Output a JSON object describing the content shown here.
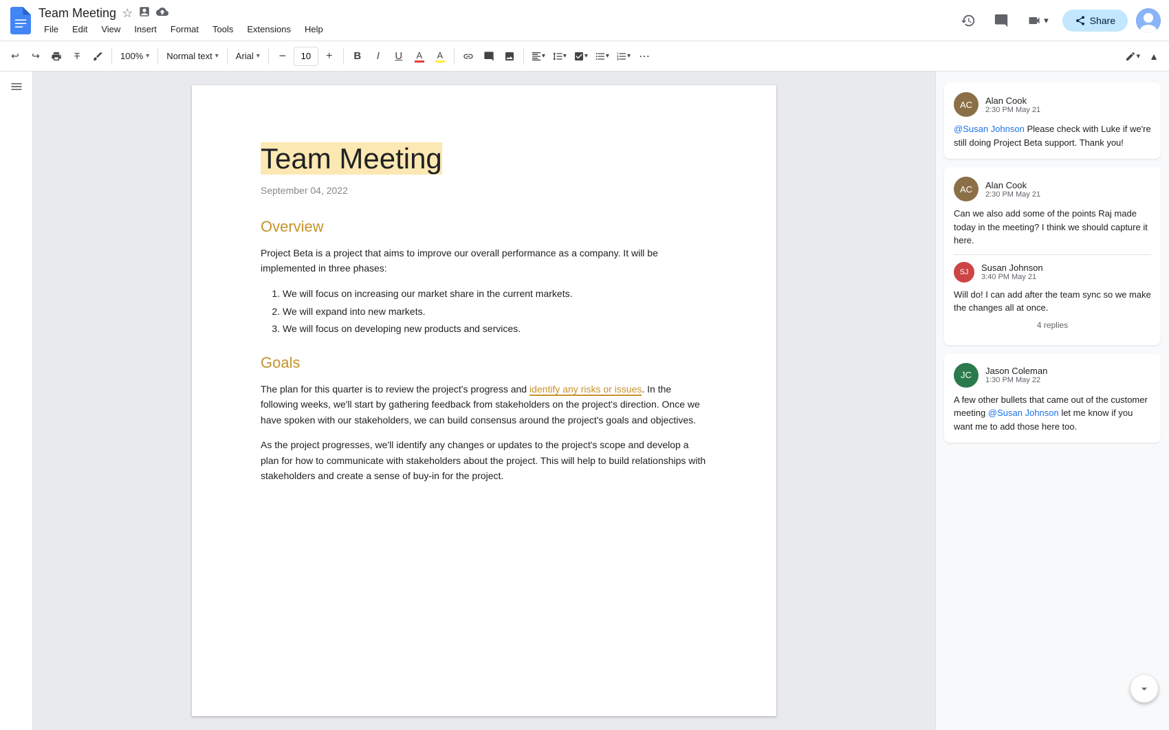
{
  "appbar": {
    "doc_title": "Team Meeting",
    "star_icon": "⭐",
    "drive_icon": "📁",
    "cloud_icon": "☁",
    "share_label": "Share",
    "history_icon": "🕐",
    "comment_icon": "💬",
    "video_icon": "📹"
  },
  "menu": {
    "items": [
      "File",
      "Edit",
      "View",
      "Insert",
      "Format",
      "Tools",
      "Extensions",
      "Help"
    ]
  },
  "toolbar": {
    "undo": "↩",
    "redo": "↪",
    "print": "🖨",
    "format_clear": "T̲",
    "paint_format": "🖌",
    "zoom": "100%",
    "text_style": "Normal text",
    "font": "Arial",
    "font_size": "10",
    "bold": "B",
    "italic": "I",
    "underline": "U",
    "text_color": "A",
    "highlight": "A",
    "link": "🔗",
    "comment": "💬",
    "image": "🖼",
    "align": "≡",
    "line_spacing": "↕",
    "checklist": "☑",
    "bullet_list": "•",
    "numbered_list": "1",
    "more": "⋯",
    "editing_mode": "✏",
    "collapse": "▲"
  },
  "document": {
    "title": "Team Meeting",
    "date": "September 04, 2022",
    "sections": [
      {
        "heading": "Overview",
        "content": "Project Beta is a project that aims to improve our overall performance as a company. It will be implemented in three phases:",
        "list": [
          "We will focus on increasing our market share in the current markets.",
          "We will expand into new markets.",
          "We will focus on developing new products and services."
        ]
      },
      {
        "heading": "Goals",
        "content_before": "The plan for this quarter is to review the project's progress and ",
        "highlighted": "identify any risks or issues",
        "content_after": ". In the following weeks, we'll start by gathering feedback from stakeholders on the project's direction. Once we have spoken with our stakeholders, we can build consensus around the project's goals and objectives.",
        "content2": "As the project progresses, we'll identify any changes or updates to the project's scope and develop a plan for how to communicate with stakeholders about the project. This will help to build relationships with stakeholders and create a sense of buy-in for the project."
      }
    ]
  },
  "comments": [
    {
      "id": "c1",
      "author": "Alan Cook",
      "time": "2:30 PM May 21",
      "avatar_bg": "#8b6f47",
      "avatar_initials": "AC",
      "body_mention": "@Susan Johnson",
      "body_text": " Please check with Luke if we're still doing Project Beta support. Thank you!",
      "replies": []
    },
    {
      "id": "c2",
      "author": "Alan Cook",
      "time": "2:30 PM May 21",
      "avatar_bg": "#8b6f47",
      "avatar_initials": "AC",
      "body": "Can we also add some of the points Raj made today in the meeting? I think we should capture it here.",
      "reply_count": "4 replies",
      "thread": [
        {
          "author": "Susan Johnson",
          "time": "3:40 PM May 21",
          "avatar_bg": "#d44",
          "avatar_initials": "SJ",
          "body": "Will do! I can add after the team sync so we make the changes all at once."
        }
      ]
    },
    {
      "id": "c3",
      "author": "Jason Coleman",
      "time": "1:30 PM May 22",
      "avatar_bg": "#5b7",
      "avatar_initials": "JC",
      "body_before": "A few other bullets that came out of the customer meeting ",
      "body_mention": "@Susan Johnson",
      "body_after": " let me know if you want me to add those here too.",
      "replies": []
    }
  ]
}
